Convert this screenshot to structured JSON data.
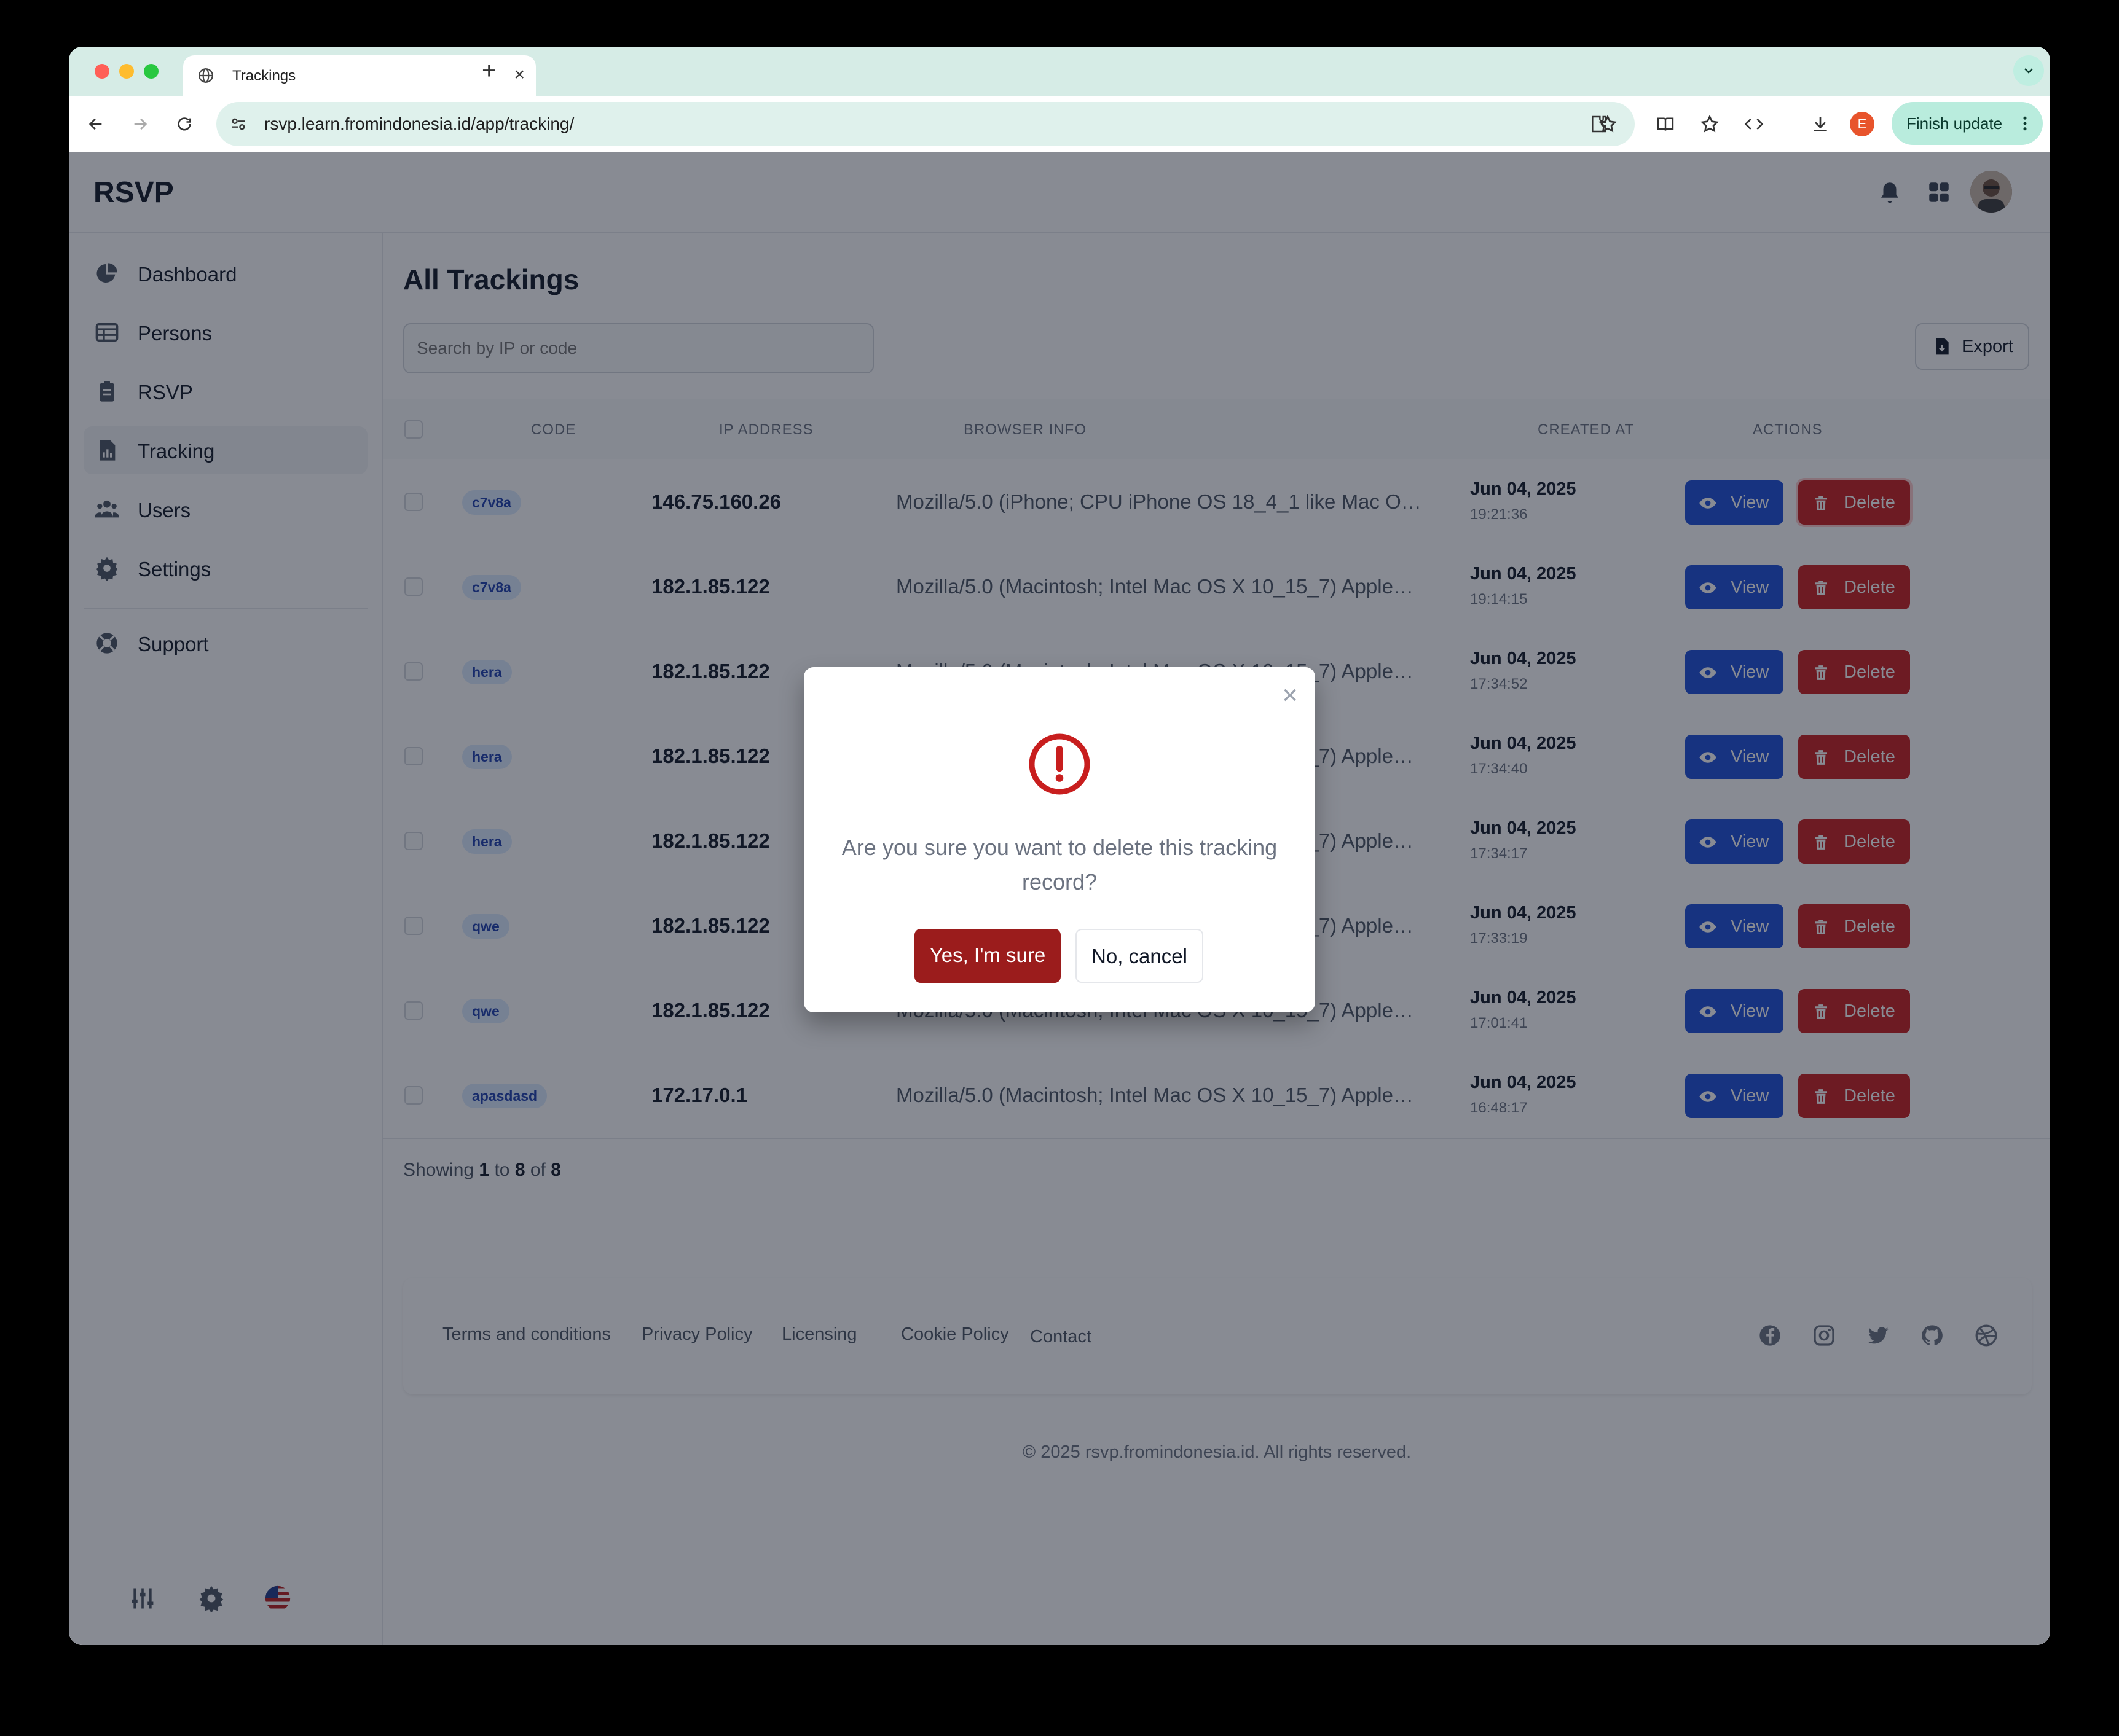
{
  "browser": {
    "tab_title": "Trackings",
    "url_host": "rsvp.learn.fromindonesia.id",
    "url_path": "/app/tracking/",
    "profile_initial": "E",
    "update_label": "Finish update"
  },
  "app": {
    "brand": "RSVP"
  },
  "sidebar": {
    "items": [
      {
        "label": "Dashboard",
        "icon": "pie-chart-icon"
      },
      {
        "label": "Persons",
        "icon": "table-icon"
      },
      {
        "label": "RSVP",
        "icon": "clipboard-icon"
      },
      {
        "label": "Tracking",
        "icon": "document-chart-icon",
        "active": true
      },
      {
        "label": "Users",
        "icon": "users-icon"
      },
      {
        "label": "Settings",
        "icon": "gear-icon"
      }
    ],
    "support_label": "Support"
  },
  "main": {
    "title": "All Trackings",
    "search_placeholder": "Search by IP or code",
    "export_label": "Export",
    "columns": [
      "CODE",
      "IP ADDRESS",
      "BROWSER INFO",
      "CREATED AT",
      "ACTIONS"
    ],
    "view_label": "View",
    "delete_label": "Delete",
    "rows": [
      {
        "code": "c7v8a",
        "ip": "146.75.160.26",
        "ua": "Mozilla/5.0 (iPhone; CPU iPhone OS 18_4_1 like Mac OS X)...",
        "date": "Jun 04, 2025",
        "time": "19:21:36"
      },
      {
        "code": "c7v8a",
        "ip": "182.1.85.122",
        "ua": "Mozilla/5.0 (Macintosh; Intel Mac OS X 10_15_7) AppleWe...",
        "date": "Jun 04, 2025",
        "time": "19:14:15"
      },
      {
        "code": "hera",
        "ip": "182.1.85.122",
        "ua": "Mozilla/5.0 (Macintosh; Intel Mac OS X 10_15_7) AppleWe...",
        "date": "Jun 04, 2025",
        "time": "17:34:52"
      },
      {
        "code": "hera",
        "ip": "182.1.85.122",
        "ua": "Mozilla/5.0 (Macintosh; Intel Mac OS X 10_15_7) AppleWe...",
        "date": "Jun 04, 2025",
        "time": "17:34:40"
      },
      {
        "code": "hera",
        "ip": "182.1.85.122",
        "ua": "Mozilla/5.0 (Macintosh; Intel Mac OS X 10_15_7) AppleWe...",
        "date": "Jun 04, 2025",
        "time": "17:34:17"
      },
      {
        "code": "qwe",
        "ip": "182.1.85.122",
        "ua": "Mozilla/5.0 (Macintosh; Intel Mac OS X 10_15_7) AppleWe...",
        "date": "Jun 04, 2025",
        "time": "17:33:19"
      },
      {
        "code": "qwe",
        "ip": "182.1.85.122",
        "ua": "Mozilla/5.0 (Macintosh; Intel Mac OS X 10_15_7) AppleWe...",
        "date": "Jun 04, 2025",
        "time": "17:01:41"
      },
      {
        "code": "apasdasd",
        "ip": "172.17.0.1",
        "ua": "Mozilla/5.0 (Macintosh; Intel Mac OS X 10_15_7) AppleWe...",
        "date": "Jun 04, 2025",
        "time": "16:48:17"
      }
    ],
    "showing": {
      "prefix": "Showing",
      "from": "1",
      "to_word": "to",
      "to": "8",
      "of_word": "of",
      "total": "8"
    }
  },
  "footer": {
    "links": [
      "Terms and conditions",
      "Privacy Policy",
      "Licensing",
      "Cookie Policy",
      "Contact"
    ],
    "social_icons": [
      "facebook-icon",
      "instagram-icon",
      "twitter-icon",
      "github-icon",
      "dribbble-icon"
    ],
    "copyright": "© 2025 rsvp.fromindonesia.id. All rights reserved."
  },
  "modal": {
    "message": "Are you sure you want to delete this tracking record?",
    "confirm_label": "Yes, I'm sure",
    "cancel_label": "No, cancel"
  },
  "colors": {
    "primary": "#1d4ed8",
    "danger": "#c81e1e",
    "danger_dark": "#9b1c1c",
    "badge_bg": "#dbeafe",
    "badge_text": "#1e40af"
  }
}
